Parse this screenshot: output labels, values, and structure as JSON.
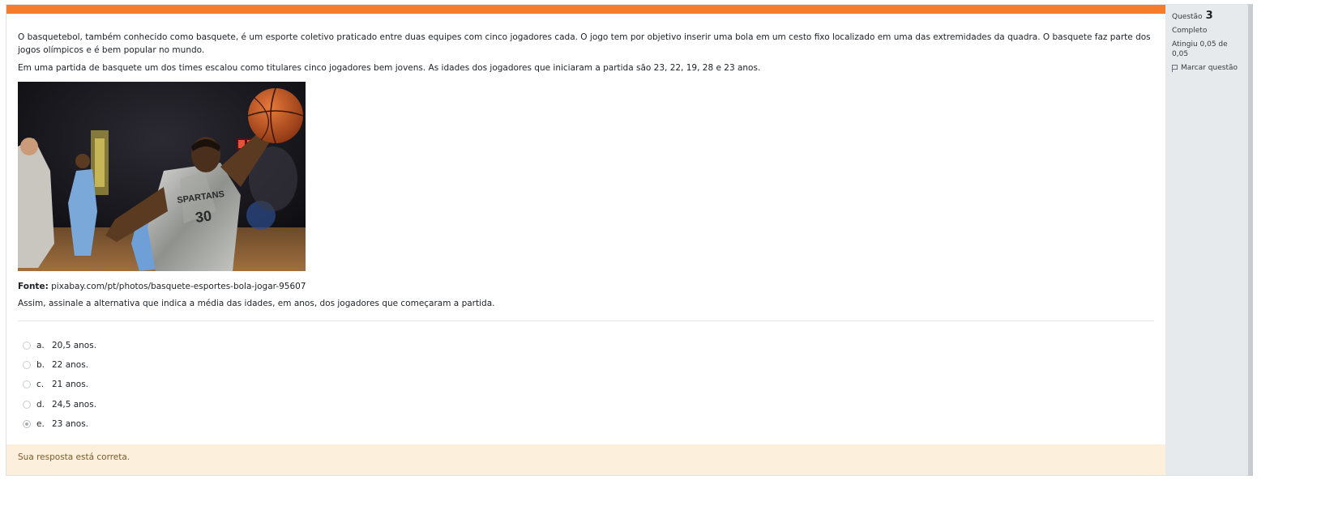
{
  "question": {
    "paragraphs": [
      "O basquetebol, também conhecido como basquete, é um esporte coletivo praticado entre duas equipes com cinco jogadores cada. O jogo tem por objetivo inserir uma bola em um cesto fixo localizado em uma das extremidades da quadra. O basquete faz parte dos jogos olímpicos e é bem popular no mundo.",
      "Em uma partida de basquete um dos times escalou como titulares cinco jogadores bem jovens. As idades dos jogadores que iniciaram a partida são 23, 22, 19, 28 e 23 anos."
    ],
    "source_label": "Fonte:",
    "source_text": "pixabay.com/pt/photos/basquete-esportes-bola-jogar-95607",
    "prompt": "Assim, assinale a alternativa que indica a média das idades, em anos, dos jogadores que começaram a partida."
  },
  "answers": [
    {
      "letter": "a.",
      "text": "20,5 anos.",
      "selected": false
    },
    {
      "letter": "b.",
      "text": "22 anos.",
      "selected": false
    },
    {
      "letter": "c.",
      "text": "21 anos.",
      "selected": false
    },
    {
      "letter": "d.",
      "text": "24,5 anos.",
      "selected": false
    },
    {
      "letter": "e.",
      "text": "23 anos.",
      "selected": true
    }
  ],
  "info": {
    "question_label": "Questão",
    "question_number": "3",
    "state": "Completo",
    "grade": "Atingiu 0,05 de 0,05",
    "flag_label": "Marcar questão"
  },
  "feedback": "Sua resposta está correta.",
  "colors": {
    "accent_bar": "#f47c2b",
    "feedback_bg": "#fcefdc",
    "feedback_text": "#7d5a29",
    "info_bg": "#e7eaed"
  },
  "photo": {
    "jersey_text": "SPARTANS",
    "jersey_number": "30"
  }
}
